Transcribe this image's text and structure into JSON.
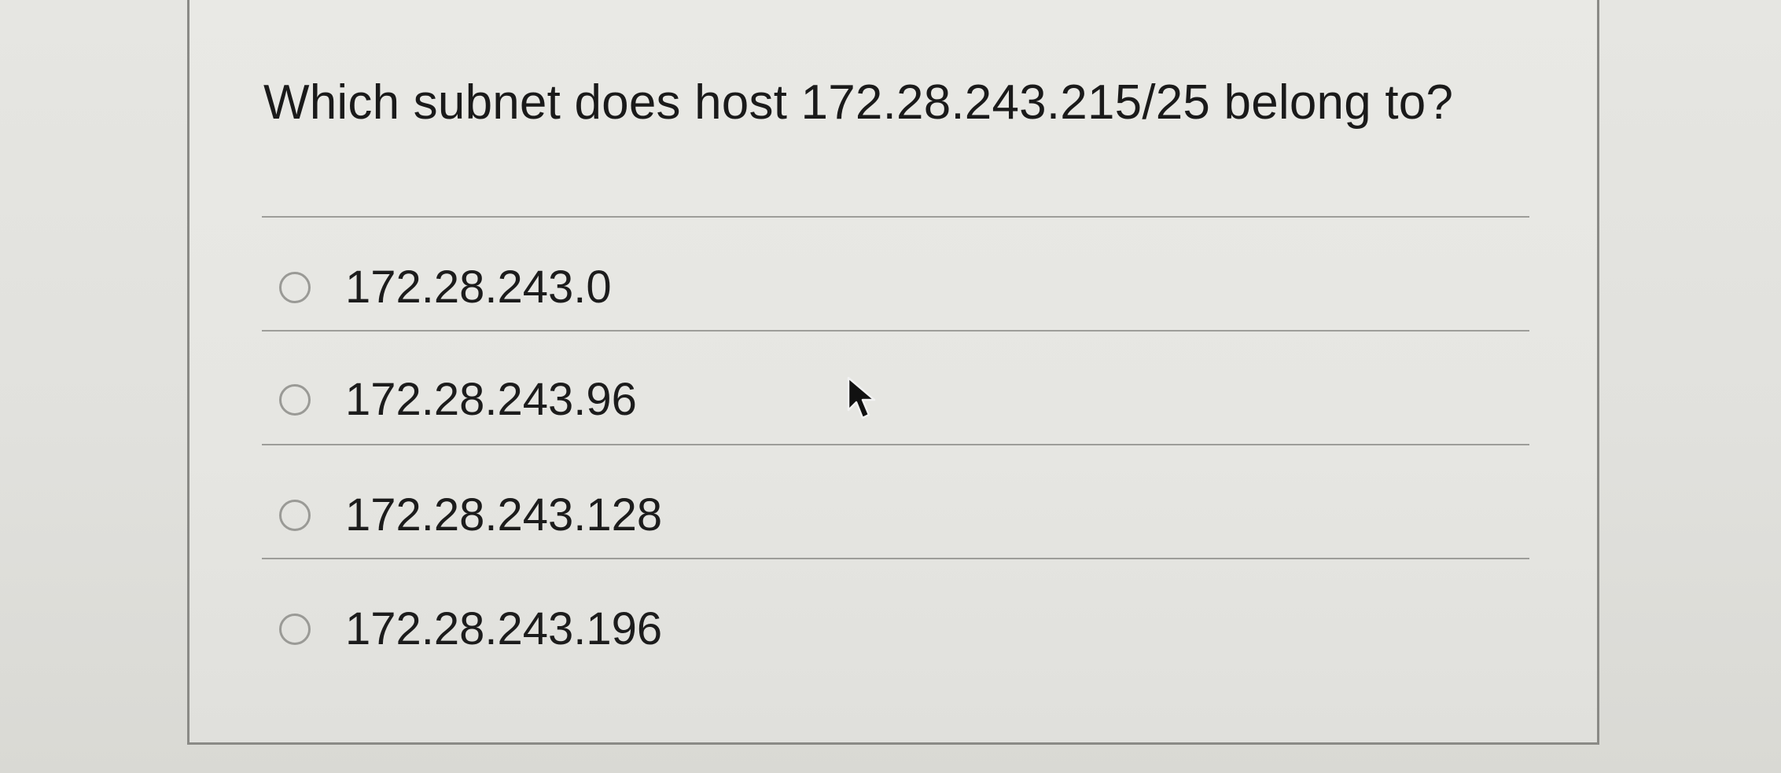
{
  "question": {
    "text": "Which subnet does host 172.28.243.215/25 belong to?"
  },
  "options": [
    {
      "label": "172.28.243.0",
      "selected": false
    },
    {
      "label": "172.28.243.96",
      "selected": false
    },
    {
      "label": "172.28.243.128",
      "selected": false
    },
    {
      "label": "172.28.243.196",
      "selected": false
    }
  ],
  "cursor": {
    "icon": "mouse-pointer-icon"
  },
  "colors": {
    "background": "#e1e1dd",
    "border": "#8a8a86",
    "divider": "#9d9d99",
    "radio_border": "#9a9a96",
    "text": "#1c1c1c"
  }
}
